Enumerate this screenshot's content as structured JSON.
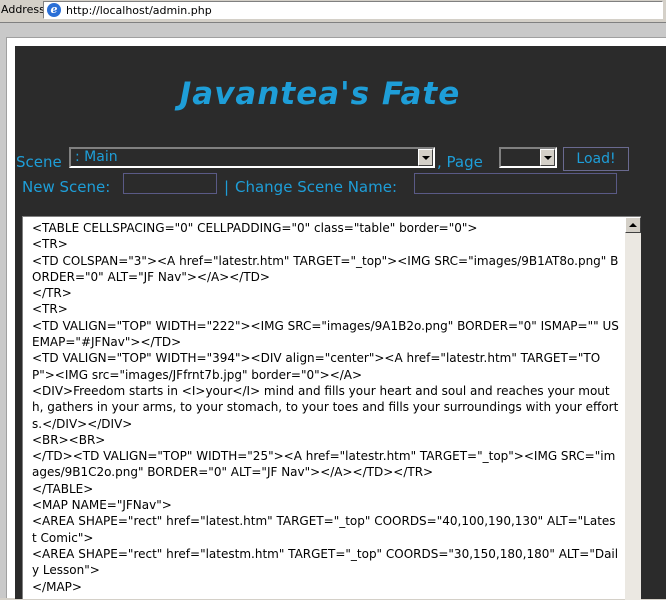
{
  "address_bar": {
    "label": "Address",
    "url": "http://localhost/admin.php"
  },
  "header": {
    "title": "Javantea's Fate"
  },
  "controls": {
    "scene_label": "Scene",
    "scene_selected": ": Main",
    "page_label": ", Page",
    "page_selected": "",
    "load_label": "Load!",
    "new_scene_label": "New Scene:",
    "new_scene_value": "",
    "separator": "|",
    "change_scene_label": "Change Scene Name:",
    "change_scene_value": ""
  },
  "editor": {
    "content": "<TABLE CELLSPACING=\"0\" CELLPADDING=\"0\" class=\"table\" border=\"0\">\n<TR>\n<TD COLSPAN=\"3\"><A href=\"latestr.htm\" TARGET=\"_top\"><IMG SRC=\"images/9B1AT8o.png\" BORDER=\"0\" ALT=\"JF Nav\"></A></TD>\n</TR>\n<TR>\n<TD VALIGN=\"TOP\" WIDTH=\"222\"><IMG SRC=\"images/9A1B2o.png\" BORDER=\"0\" ISMAP=\"\" USEMAP=\"#JFNav\"></TD>\n<TD VALIGN=\"TOP\" WIDTH=\"394\"><DIV align=\"center\"><A href=\"latestr.htm\" TARGET=\"TOP\"><IMG src=\"images/JFfrnt7b.jpg\" border=\"0\"></A>\n<DIV>Freedom starts in <I>your</I> mind and fills your heart and soul and reaches your mouth, gathers in your arms, to your stomach, to your toes and fills your surroundings with your efforts.</DIV></DIV>\n<BR><BR>\n</TD><TD VALIGN=\"TOP\" WIDTH=\"25\"><A href=\"latestr.htm\" TARGET=\"_top\"><IMG SRC=\"images/9B1C2o.png\" BORDER=\"0\" ALT=\"JF Nav\"></A></TD></TR>\n</TABLE>\n<MAP NAME=\"JFNav\">\n<AREA SHAPE=\"rect\" href=\"latest.htm\" TARGET=\"_top\" COORDS=\"40,100,190,130\" ALT=\"Latest Comic\">\n<AREA SHAPE=\"rect\" href=\"latestm.htm\" TARGET=\"_top\" COORDS=\"30,150,180,180\" ALT=\"Daily Lesson\">\n</MAP>"
  },
  "colors": {
    "accent": "#1e9ed8",
    "panel_bg": "#2b2b2b",
    "page_bg": "#c9c9c9"
  }
}
